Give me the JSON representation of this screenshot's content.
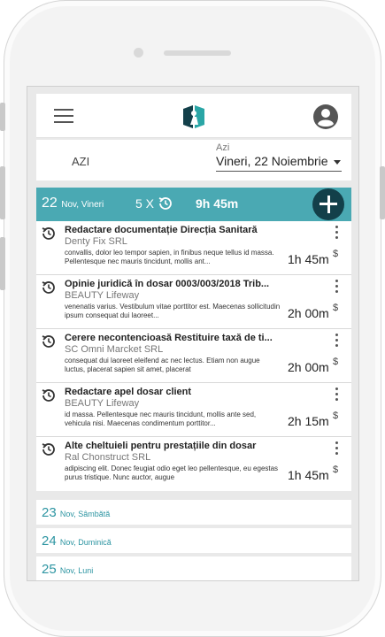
{
  "header": {
    "menu_icon": "hamburger-icon",
    "logo": "app-logo",
    "user_icon": "account-circle-icon"
  },
  "datebar": {
    "today_label": "AZI",
    "select_label": "Azi",
    "select_value": "Vineri, 22 Noiembrie"
  },
  "current_day": {
    "day_num": "22",
    "day_name": "Nov, Vineri",
    "count": "5 X",
    "total": "9h 45m",
    "accent": "#4aa9b3"
  },
  "entries": [
    {
      "title": "Redactare documentație Direcția Sanitară",
      "client": "Denty Fix SRL",
      "desc": "convallis, dolor leo tempor sapien, in finibus neque tellus id massa. Pellentesque nec mauris tincidunt, mollis ant...",
      "duration": "1h 45m",
      "currency": "$"
    },
    {
      "title": "Opinie juridică în dosar 0003/003/2018 Trib...",
      "client": "BEAUTY Lifeway",
      "desc": "venenatis varius. Vestibulum vitae porttitor est. Maecenas sollicitudin ipsum consequat dui laoreet...",
      "duration": "2h 00m",
      "currency": "$"
    },
    {
      "title": "Cerere necontencioasă Restituire taxă de ti...",
      "client": "SC Omni Marcket SRL",
      "desc": "consequat dui laoreet eleifend ac nec lectus. Etiam non augue luctus, placerat sapien sit amet, placerat",
      "duration": "2h 00m",
      "currency": "$"
    },
    {
      "title": "Redactare apel dosar client",
      "client": "BEAUTY Lifeway",
      "desc": "id massa. Pellentesque nec mauris tincidunt, mollis ante sed, vehicula nisi. Maecenas condimentum porttitor...",
      "duration": "2h 15m",
      "currency": "$"
    },
    {
      "title": "Alte cheltuieli pentru prestațiile din dosar",
      "client": "Ral Chonstruct SRL",
      "desc": "adipiscing elit. Donec feugiat odio eget leo pellentesque, eu egestas purus tristique. Nunc auctor, augue",
      "duration": "1h 45m",
      "currency": "$"
    }
  ],
  "other_days": [
    {
      "num": "23",
      "label": "Nov, Sâmbătă"
    },
    {
      "num": "24",
      "label": "Nov, Duminică"
    },
    {
      "num": "25",
      "label": "Nov, Luni"
    }
  ]
}
